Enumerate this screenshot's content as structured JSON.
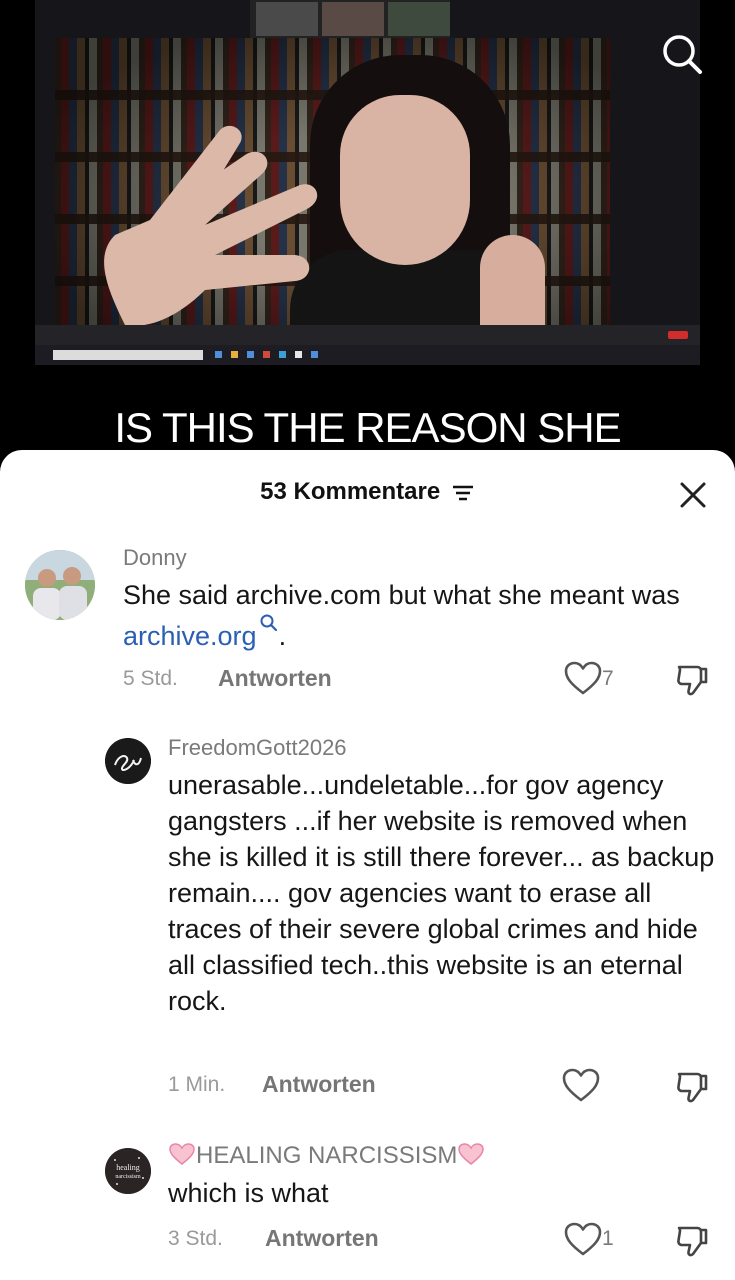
{
  "video": {
    "caption": "IS THIS THE REASON SHE",
    "search_icon": "search-icon"
  },
  "sheet": {
    "comment_count_label": "53 Kommentare",
    "filter_icon": "filter-icon",
    "close_icon": "close-icon"
  },
  "comments": [
    {
      "user": "Donny",
      "text_before": "She said archive.com but what she meant was ",
      "link_text": "archive.org",
      "text_after": ".",
      "time": "5 Std.",
      "reply_label": "Antworten",
      "likes": "7"
    },
    {
      "user": "FreedomGott2026",
      "text": "unerasable...undeletable...for gov agency gangsters ...if her website is removed when she is killed it is still there forever... as backup remain.... gov agencies want to erase all traces of their severe global crimes and hide all classified tech..this website is an eternal rock.",
      "time": "1 Min.",
      "reply_label": "Antworten",
      "likes": ""
    },
    {
      "user": "HEALING NARCISSISM",
      "avatar_text": "healing narcissism",
      "text": "which is what",
      "time": "3 Std.",
      "reply_label": "Antworten",
      "likes": "1"
    }
  ],
  "colors": {
    "link": "#2b5fb4",
    "meta": "#9a9a9a",
    "heart_pink": "#f29bb5"
  }
}
